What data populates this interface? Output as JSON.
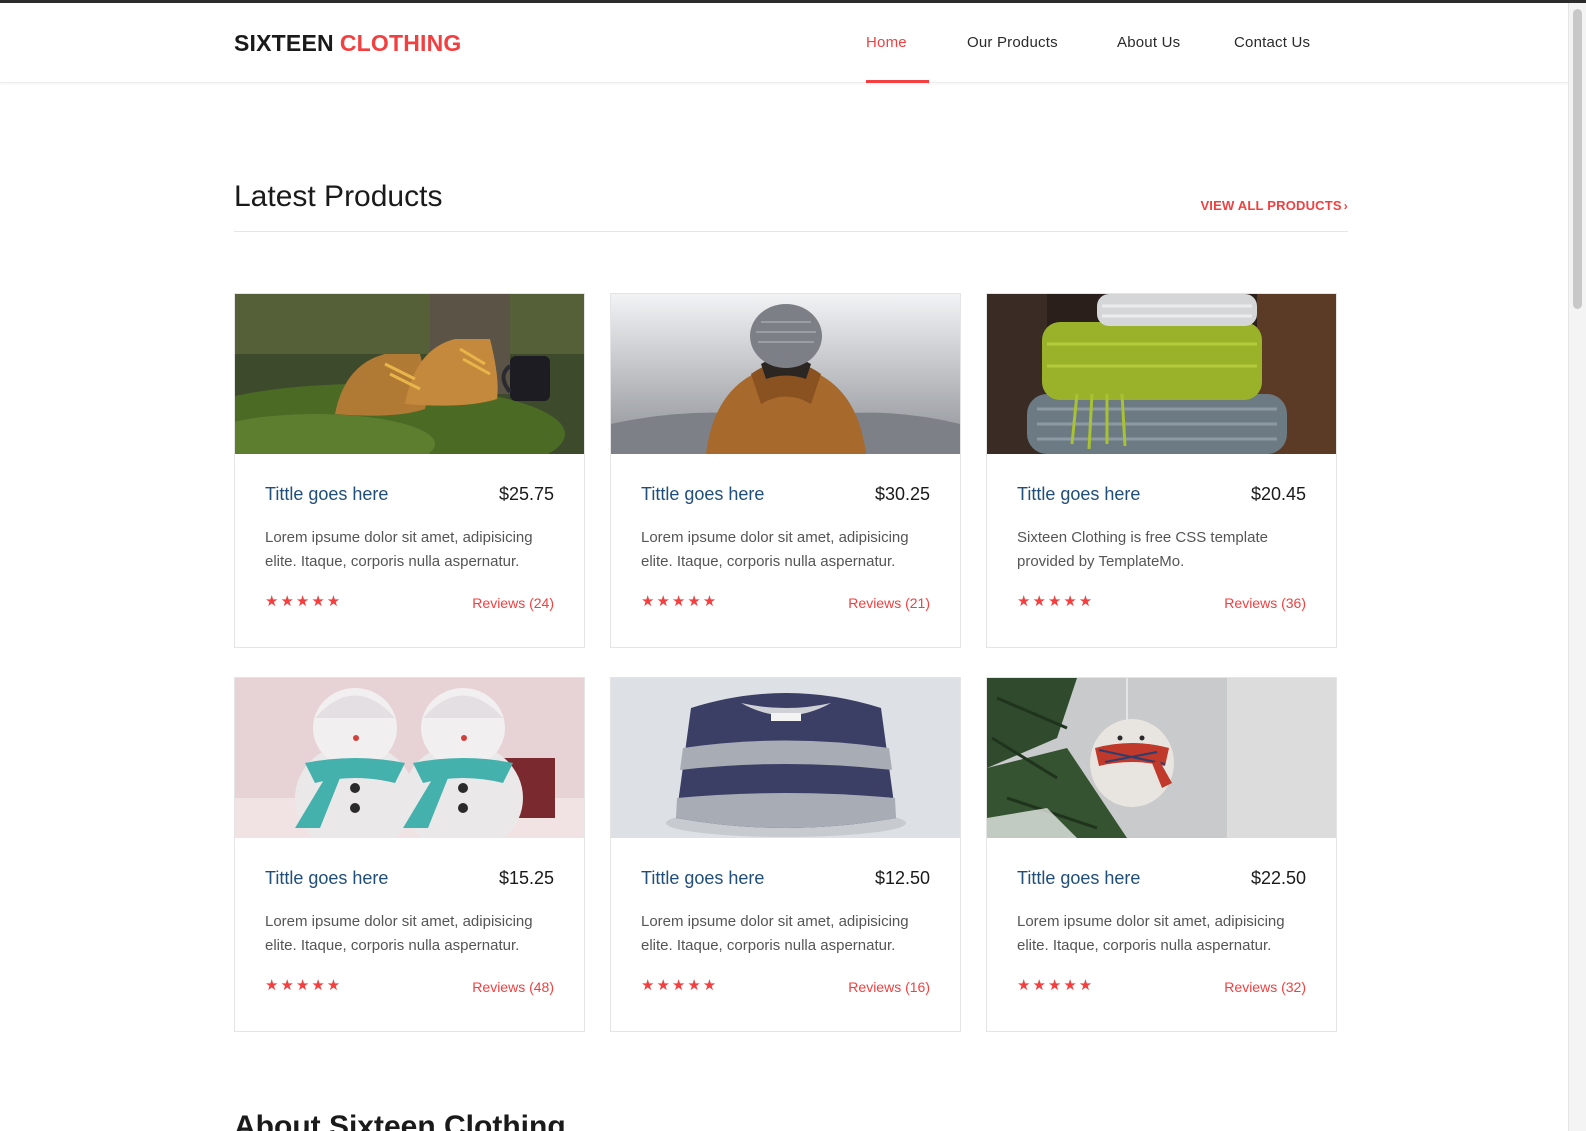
{
  "brand": {
    "name_part1": "SIXTEEN",
    "name_part2": "CLOTHING",
    "accent_color": "#f33f3f"
  },
  "nav": {
    "items": [
      {
        "label": "Home",
        "active": true
      },
      {
        "label": "Our Products",
        "active": false
      },
      {
        "label": "About Us",
        "active": false
      },
      {
        "label": "Contact Us",
        "active": false
      }
    ]
  },
  "section": {
    "title": "Latest Products",
    "view_all": "VIEW ALL PRODUCTS",
    "view_all_icon": "chevron-right-icon"
  },
  "products": [
    {
      "title": "Tittle goes here",
      "price": "$25.75",
      "description": "Lorem ipsume dolor sit amet, adipisicing elite. Itaque, corporis nulla aspernatur.",
      "rating": 5,
      "reviews": "Reviews (24)",
      "image": "boots-icon"
    },
    {
      "title": "Tittle goes here",
      "price": "$30.25",
      "description": "Lorem ipsume dolor sit amet, adipisicing elite. Itaque, corporis nulla aspernatur.",
      "rating": 5,
      "reviews": "Reviews (21)",
      "image": "hooded-person-icon"
    },
    {
      "title": "Tittle goes here",
      "price": "$20.45",
      "description": "Sixteen Clothing is free CSS template provided by TemplateMo.",
      "rating": 5,
      "reviews": "Reviews (36)",
      "image": "folded-scarves-icon"
    },
    {
      "title": "Tittle goes here",
      "price": "$15.25",
      "description": "Lorem ipsume dolor sit amet, adipisicing elite. Itaque, corporis nulla aspernatur.",
      "rating": 5,
      "reviews": "Reviews (48)",
      "image": "snowmen-icon"
    },
    {
      "title": "Tittle goes here",
      "price": "$12.50",
      "description": "Lorem ipsume dolor sit amet, adipisicing elite. Itaque, corporis nulla aspernatur.",
      "rating": 5,
      "reviews": "Reviews (16)",
      "image": "striped-sweater-icon"
    },
    {
      "title": "Tittle goes here",
      "price": "$22.50",
      "description": "Lorem ipsume dolor sit amet, adipisicing elite. Itaque, corporis nulla aspernatur.",
      "rating": 5,
      "reviews": "Reviews (32)",
      "image": "ornament-icon"
    }
  ],
  "about": {
    "title": "About Sixteen Clothing"
  }
}
